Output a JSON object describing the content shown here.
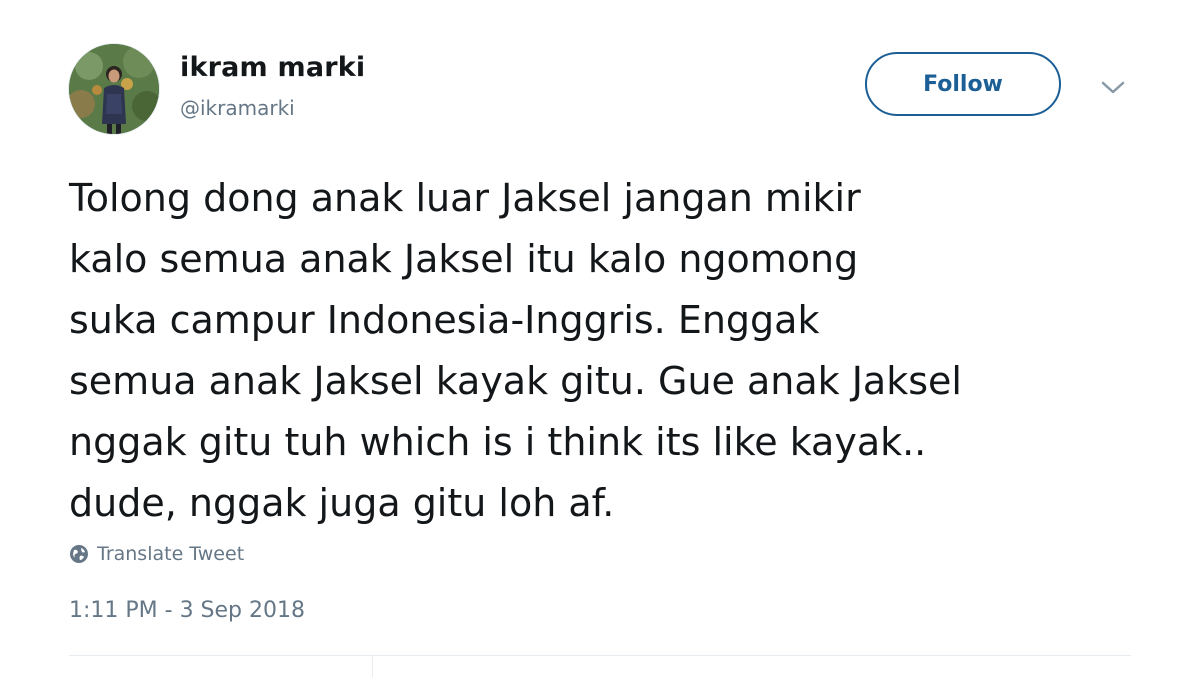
{
  "user": {
    "display_name": "ikram marki",
    "handle": "@ikramarki",
    "avatar_icon": "profile-photo"
  },
  "actions": {
    "follow_label": "Follow",
    "menu_icon": "chevron-down-icon"
  },
  "tweet": {
    "text": "Tolong dong anak luar Jaksel jangan mikir\nkalo semua anak Jaksel itu kalo ngomong\nsuka campur Indonesia-Inggris. Enggak\nsemua anak Jaksel kayak gitu. Gue anak Jaksel\nnggak gitu tuh which is i think its like kayak..\ndude, nggak juga gitu loh af.",
    "translate_label": "Translate Tweet",
    "translate_icon": "globe-icon",
    "timestamp": "1:11 PM - 3 Sep 2018"
  },
  "colors": {
    "accent": "#1b5f96",
    "text": "#14171a",
    "secondary": "#657786",
    "divider": "#e6ecf0"
  }
}
